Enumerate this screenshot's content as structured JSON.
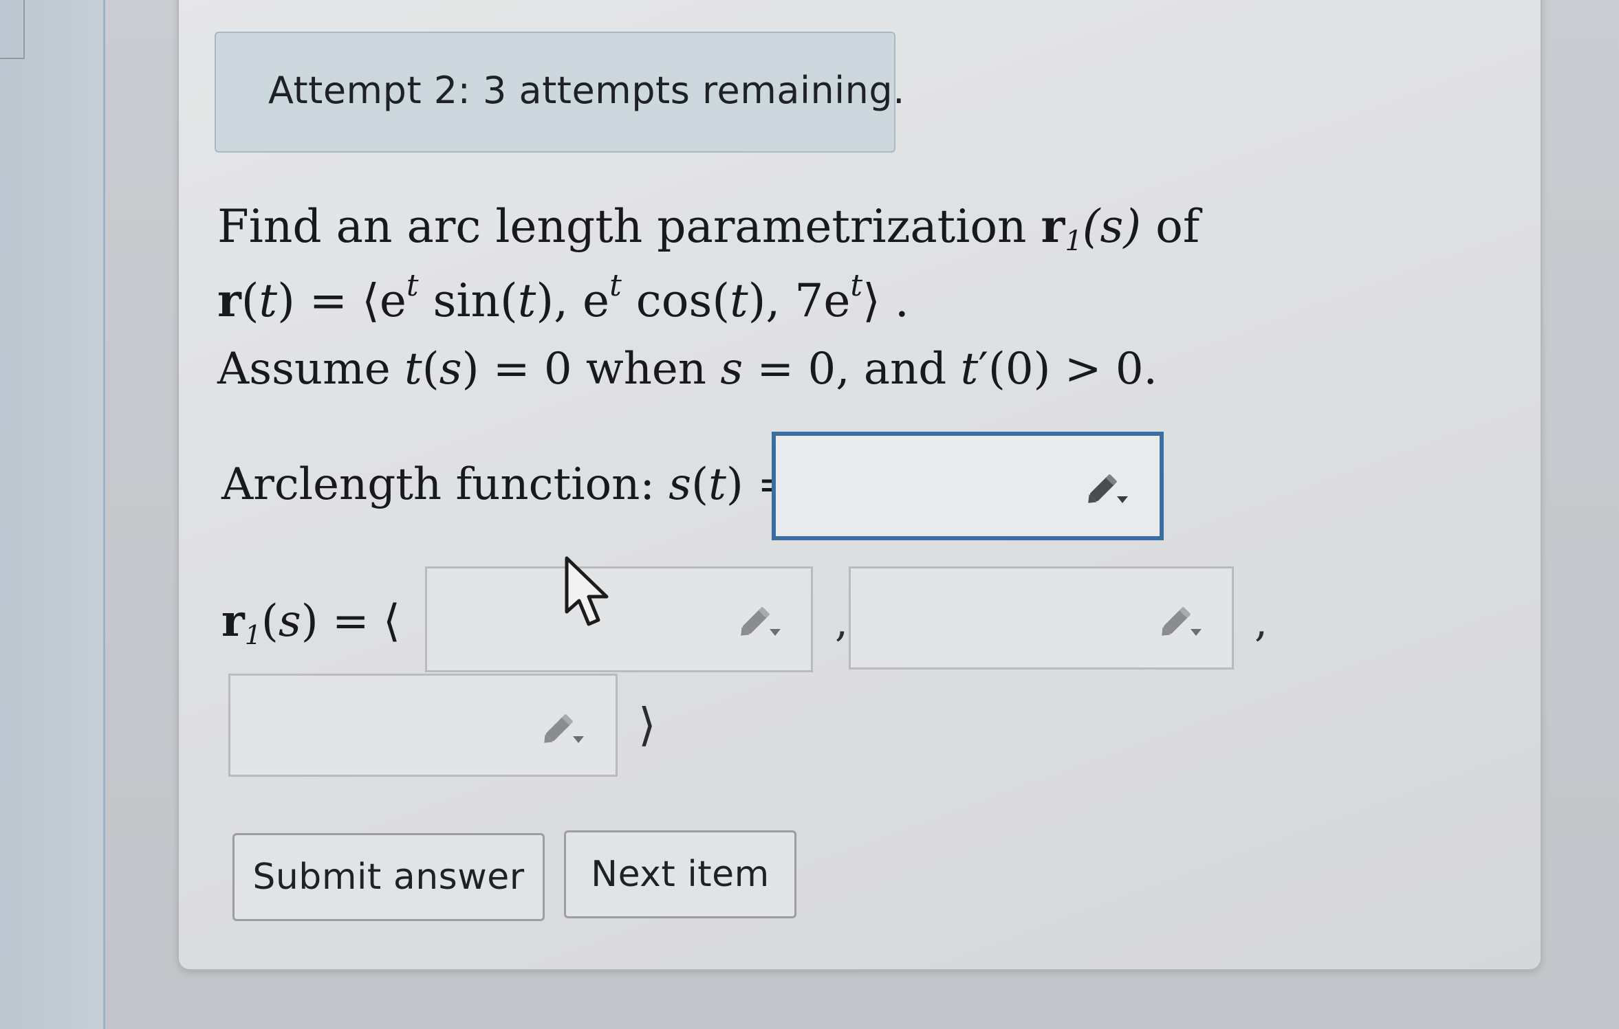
{
  "status": {
    "attempt_text": "Attempt 2: 3 attempts remaining."
  },
  "problem": {
    "line1_text": "Find an arc length parametrization",
    "line1_r": "r",
    "line1_sub": "1",
    "line1_arg": "(s)",
    "line1_of": " of",
    "line2_r": "r",
    "line2_rest_a": "(",
    "line2_t": "t",
    "line2_rest_b": ") = ⟨e",
    "line2_sup1": "t",
    "line2_sin": " sin(",
    "line2_t2": "t",
    "line2_mid": "), e",
    "line2_sup2": "t",
    "line2_cos": " cos(",
    "line2_t3": "t",
    "line2_end": "), 7e",
    "line2_sup3": "t",
    "line2_close": "⟩ .",
    "line3_assume": "Assume ",
    "line3_t": "t",
    "line3_p1": "(",
    "line3_s": "s",
    "line3_p2": ") = 0 when ",
    "line3_s2": "s",
    "line3_p3": " = 0, and ",
    "line3_t2": "t",
    "line3_p4": "′(0) > 0."
  },
  "arclength": {
    "label_text": "Arclength function: ",
    "label_s": "s",
    "label_p1": "(",
    "label_t": "t",
    "label_p2": ") =",
    "input_value": ""
  },
  "r1": {
    "label_r": "r",
    "label_sub": "1",
    "label_p1": "(",
    "label_s": "s",
    "label_p2": ") = ⟨",
    "comp1_value": "",
    "comp2_value": "",
    "comp3_value": "",
    "comma": ",",
    "close": "⟩"
  },
  "actions": {
    "submit_label": "Submit answer",
    "next_label": "Next item"
  },
  "icons": {
    "input_tool": "pencil-dropdown-icon",
    "pointer": "mouse-cursor-icon"
  },
  "colors": {
    "active_border": "#3b6ea0",
    "attempt_bg": "#cdd7de"
  }
}
